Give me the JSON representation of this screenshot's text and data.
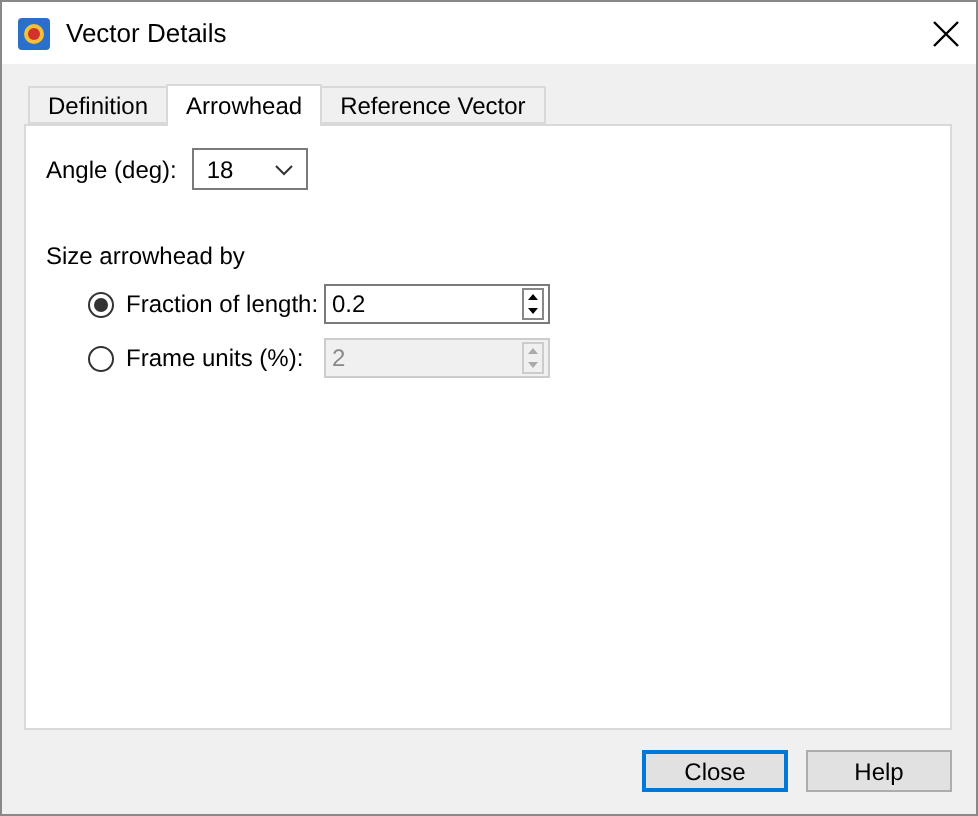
{
  "window": {
    "title": "Vector Details"
  },
  "tabs": [
    {
      "label": "Definition",
      "selected": false
    },
    {
      "label": "Arrowhead",
      "selected": true
    },
    {
      "label": "Reference Vector",
      "selected": false
    }
  ],
  "angle": {
    "label": "Angle (deg):",
    "value": "18"
  },
  "size_group": {
    "label": "Size arrowhead by",
    "options": [
      {
        "label": "Fraction of length:",
        "selected": true,
        "value": "0.2",
        "disabled": false
      },
      {
        "label": "Frame units (%):",
        "selected": false,
        "value": "2",
        "disabled": true
      }
    ]
  },
  "buttons": [
    {
      "label": "Close",
      "focused": true
    },
    {
      "label": "Help",
      "focused": false
    }
  ]
}
